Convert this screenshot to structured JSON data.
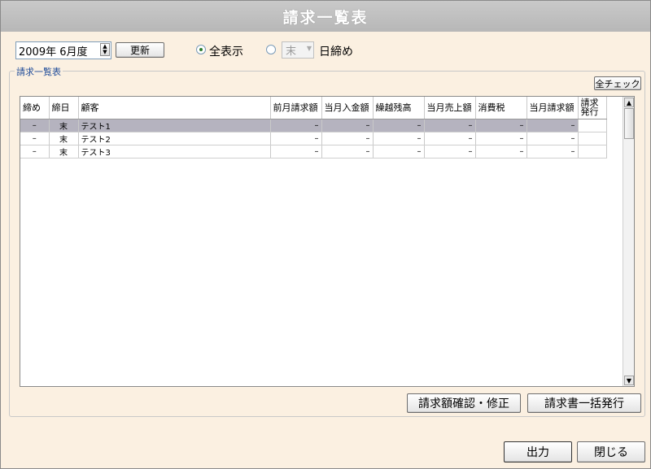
{
  "window": {
    "title": "請求一覧表"
  },
  "toolbar": {
    "date_value": "2009年  6月度",
    "update_label": "更新",
    "radio_all_label": "全表示",
    "radio_close_label": "日締め",
    "close_select_value": "末"
  },
  "group": {
    "label": "請求一覧表",
    "check_all_label": "全チェック"
  },
  "table": {
    "headers": [
      "締め",
      "締日",
      "顧客",
      "前月請求額",
      "当月入金額",
      "繰越残高",
      "当月売上額",
      "消費税",
      "当月請求額",
      "請求発行"
    ],
    "rows": [
      {
        "shime": "–",
        "shimebi": "末",
        "customer": "テスト1",
        "prev": "–",
        "paid": "–",
        "carry": "–",
        "sales": "–",
        "tax": "–",
        "bill": "–"
      },
      {
        "shime": "–",
        "shimebi": "末",
        "customer": "テスト2",
        "prev": "–",
        "paid": "–",
        "carry": "–",
        "sales": "–",
        "tax": "–",
        "bill": "–"
      },
      {
        "shime": "–",
        "shimebi": "末",
        "customer": "テスト3",
        "prev": "–",
        "paid": "–",
        "carry": "–",
        "sales": "–",
        "tax": "–",
        "bill": "–"
      }
    ]
  },
  "actions": {
    "confirm_label": "請求額確認・修正",
    "issue_all_label": "請求書一括発行",
    "output_label": "出力",
    "close_label": "閉じる"
  }
}
